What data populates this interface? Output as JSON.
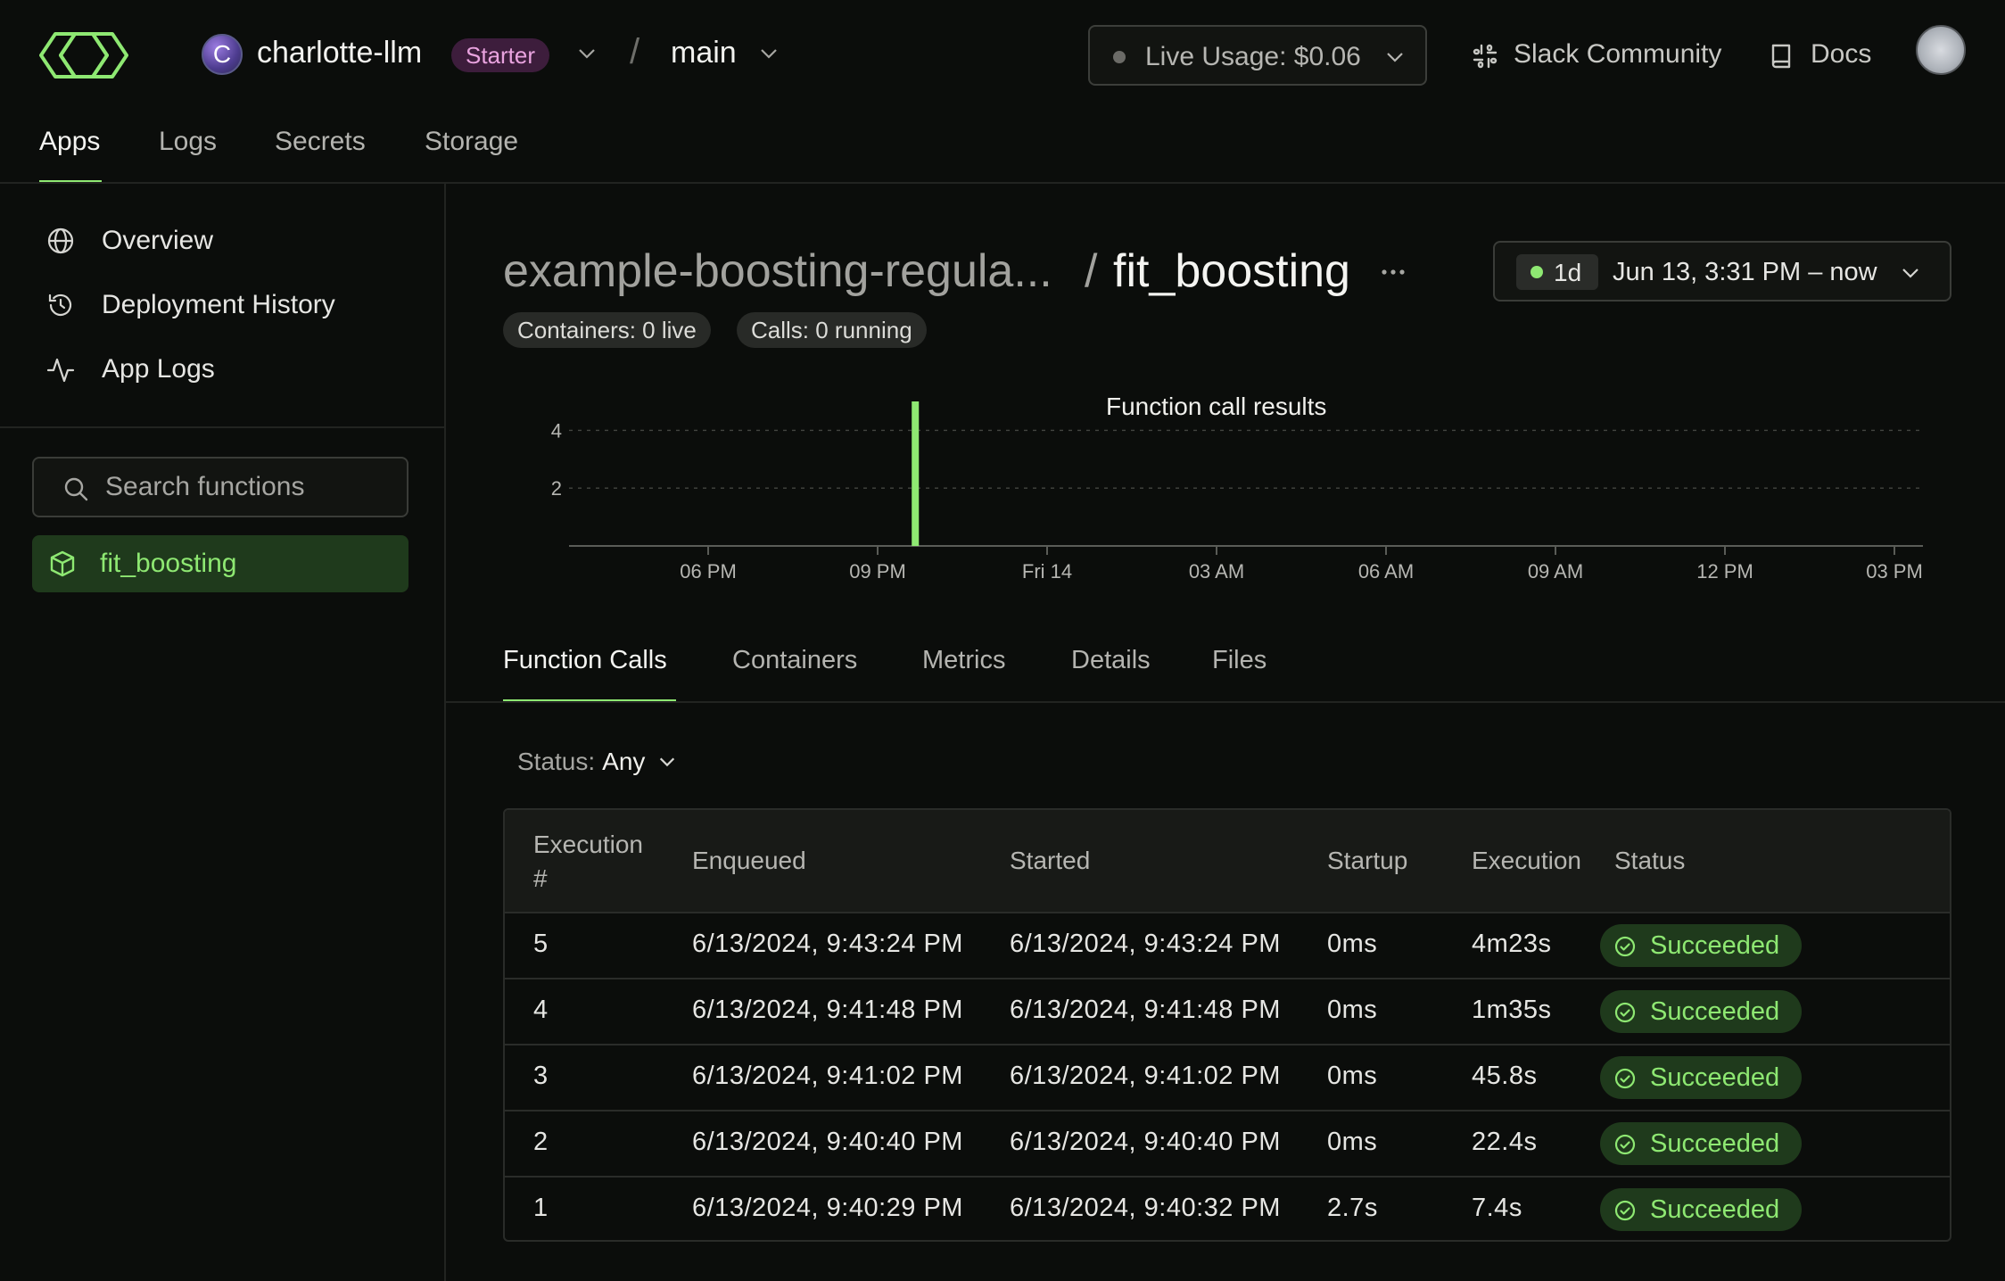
{
  "header": {
    "org_initial": "C",
    "org_name": "charlotte-llm",
    "plan": "Starter",
    "separator": "/",
    "environment": "main",
    "live_usage": "Live Usage: $0.06",
    "slack": "Slack Community",
    "docs": "Docs",
    "colors": {
      "accent": "#8ee872",
      "plan_badge_bg": "#3d1d3c",
      "plan_badge_fg": "#e9a3df"
    }
  },
  "nav": {
    "tabs": [
      {
        "label": "Apps",
        "active": true
      },
      {
        "label": "Logs",
        "active": false
      },
      {
        "label": "Secrets",
        "active": false
      },
      {
        "label": "Storage",
        "active": false
      }
    ]
  },
  "sidebar": {
    "items": [
      {
        "label": "Overview",
        "icon": "globe-icon"
      },
      {
        "label": "Deployment History",
        "icon": "history-icon"
      },
      {
        "label": "App Logs",
        "icon": "activity-icon"
      }
    ],
    "search": {
      "placeholder": "Search functions",
      "value": ""
    },
    "functions": [
      {
        "label": "fit_boosting",
        "icon": "cube-icon",
        "selected": true
      }
    ]
  },
  "page": {
    "app_name": "example-boosting-regula...",
    "separator": "/",
    "function_name": "fit_boosting",
    "pills": {
      "containers": "Containers: 0 live",
      "calls": "Calls: 0 running"
    },
    "time_range": {
      "badge": "1d",
      "label": "Jun 13, 3:31 PM – now"
    }
  },
  "chart_data": {
    "type": "bar",
    "title": "Function call results",
    "xlabel": "",
    "ylabel": "",
    "x_ticks": [
      "06 PM",
      "09 PM",
      "Fri 14",
      "03 AM",
      "06 AM",
      "09 AM",
      "12 PM",
      "03 PM"
    ],
    "y_ticks": [
      2,
      4
    ],
    "ylim": [
      0,
      5
    ],
    "x_range": [
      "Jun 13, 3:31 PM",
      "Jun 14, 3:31 PM"
    ],
    "grid": true,
    "series": [
      {
        "values": [
          {
            "x": "Jun 13, 9:40 PM",
            "y": 5
          }
        ],
        "color": "#8ee872"
      }
    ]
  },
  "sub_tabs": [
    {
      "label": "Function Calls",
      "active": true
    },
    {
      "label": "Containers",
      "active": false
    },
    {
      "label": "Metrics",
      "active": false
    },
    {
      "label": "Details",
      "active": false
    },
    {
      "label": "Files",
      "active": false
    }
  ],
  "filter": {
    "label": "Status:",
    "value": "Any"
  },
  "table": {
    "columns": [
      "Execution #",
      "Enqueued",
      "Started",
      "Startup",
      "Execution",
      "Status"
    ],
    "rows": [
      {
        "execution_num": "5",
        "enqueued": "6/13/2024, 9:43:24 PM",
        "started": "6/13/2024, 9:43:24 PM",
        "startup": "0ms",
        "execution": "4m23s",
        "status": "Succeeded"
      },
      {
        "execution_num": "4",
        "enqueued": "6/13/2024, 9:41:48 PM",
        "started": "6/13/2024, 9:41:48 PM",
        "startup": "0ms",
        "execution": "1m35s",
        "status": "Succeeded"
      },
      {
        "execution_num": "3",
        "enqueued": "6/13/2024, 9:41:02 PM",
        "started": "6/13/2024, 9:41:02 PM",
        "startup": "0ms",
        "execution": "45.8s",
        "status": "Succeeded"
      },
      {
        "execution_num": "2",
        "enqueued": "6/13/2024, 9:40:40 PM",
        "started": "6/13/2024, 9:40:40 PM",
        "startup": "0ms",
        "execution": "22.4s",
        "status": "Succeeded"
      },
      {
        "execution_num": "1",
        "enqueued": "6/13/2024, 9:40:29 PM",
        "started": "6/13/2024, 9:40:32 PM",
        "startup": "2.7s",
        "execution": "7.4s",
        "status": "Succeeded"
      }
    ]
  }
}
